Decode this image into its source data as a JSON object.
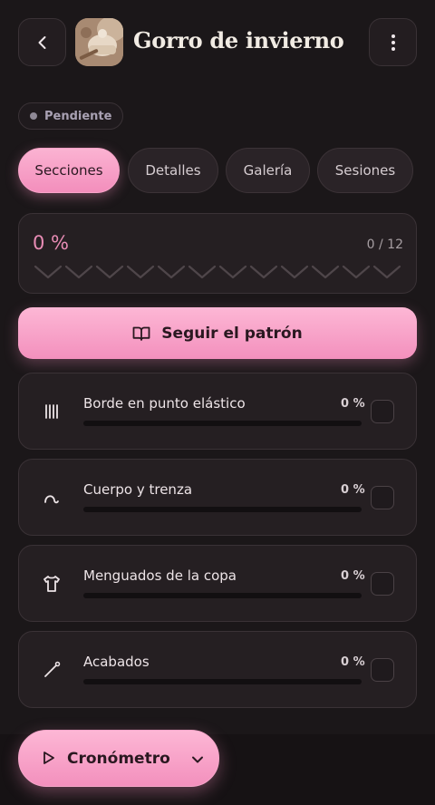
{
  "header": {
    "title": "Gorro de invierno",
    "back_icon": "chevron-left-icon",
    "more_icon": "more-vertical-icon"
  },
  "status": {
    "label": "Pendiente"
  },
  "tabs": [
    {
      "label": "Secciones",
      "active": true
    },
    {
      "label": "Detalles",
      "active": false
    },
    {
      "label": "Galería",
      "active": false
    },
    {
      "label": "Sesiones",
      "active": false
    }
  ],
  "progress": {
    "percent_label": "0 %",
    "count_label": "0 / 12",
    "value": 0,
    "done": 0,
    "total": 12
  },
  "follow_button": {
    "label": "Seguir el patrón",
    "icon": "book-open-icon"
  },
  "sections": [
    {
      "name": "Borde en punto elástico",
      "percent": "0 %",
      "progress": 0,
      "icon": "ribbing-icon"
    },
    {
      "name": "Cuerpo y trenza",
      "percent": "0 %",
      "progress": 0,
      "icon": "curve-icon"
    },
    {
      "name": "Menguados de la copa",
      "percent": "0 %",
      "progress": 0,
      "icon": "shirt-icon"
    },
    {
      "name": "Acabados",
      "percent": "0 %",
      "progress": 0,
      "icon": "needle-icon"
    }
  ],
  "timer": {
    "label": "Cronómetro",
    "icon": "play-icon",
    "chevron": "chevron-down-icon"
  },
  "colors": {
    "accent": "#f59bc3",
    "background": "#1b1719",
    "card": "#251f22"
  }
}
